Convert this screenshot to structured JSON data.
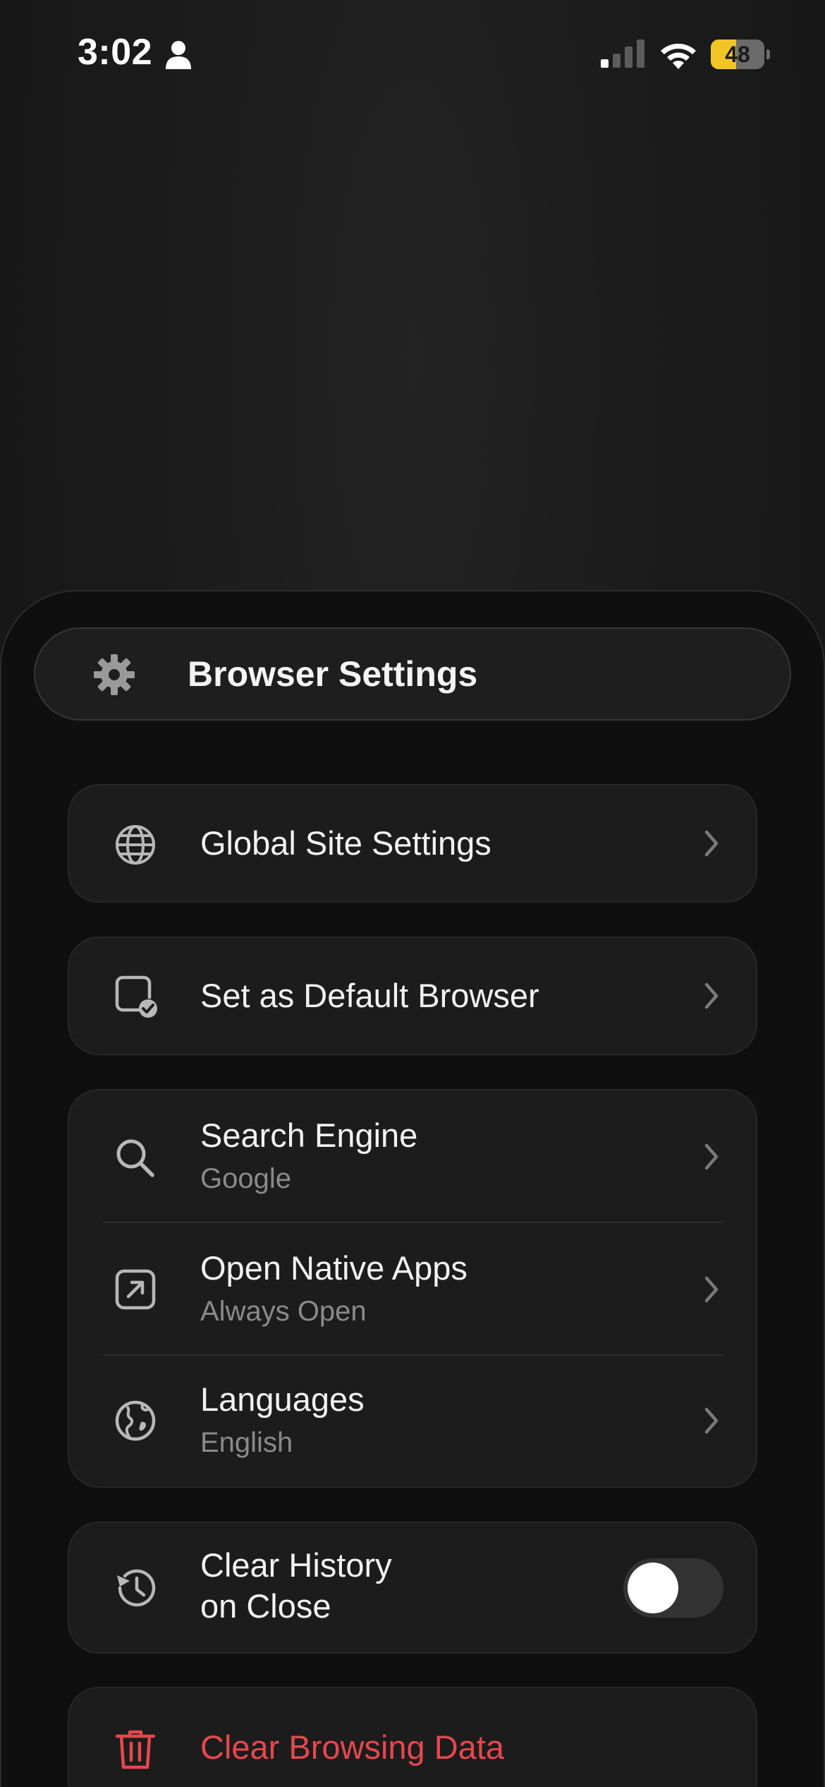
{
  "status_bar": {
    "time": "3:02",
    "battery": "48",
    "battery_level": 0.48,
    "icons": [
      "person-icon",
      "cellular-signal-icon",
      "wifi-icon",
      "battery-icon"
    ]
  },
  "header": {
    "title": "Browser Settings",
    "icon": "gear-icon"
  },
  "settings": {
    "global_site_settings": {
      "label": "Global Site Settings",
      "icon": "globe-icon"
    },
    "default_browser": {
      "label": "Set as Default Browser",
      "icon": "device-check-icon"
    },
    "search_engine": {
      "label": "Search Engine",
      "value": "Google",
      "icon": "search-icon"
    },
    "open_native_apps": {
      "label": "Open Native Apps",
      "value": "Always Open",
      "icon": "open-external-icon"
    },
    "languages": {
      "label": "Languages",
      "value": "English",
      "icon": "language-globe-icon"
    },
    "clear_history": {
      "label_line1": "Clear History",
      "label_line2": "on Close",
      "enabled": false,
      "icon": "history-icon"
    },
    "clear_browsing_data": {
      "label": "Clear Browsing Data",
      "icon": "trash-icon"
    }
  },
  "colors": {
    "accent_danger": "#e5484d",
    "battery_fill": "#f2c527",
    "card_bg": "#1c1c1c",
    "sheet_bg": "#0f0f0f"
  }
}
